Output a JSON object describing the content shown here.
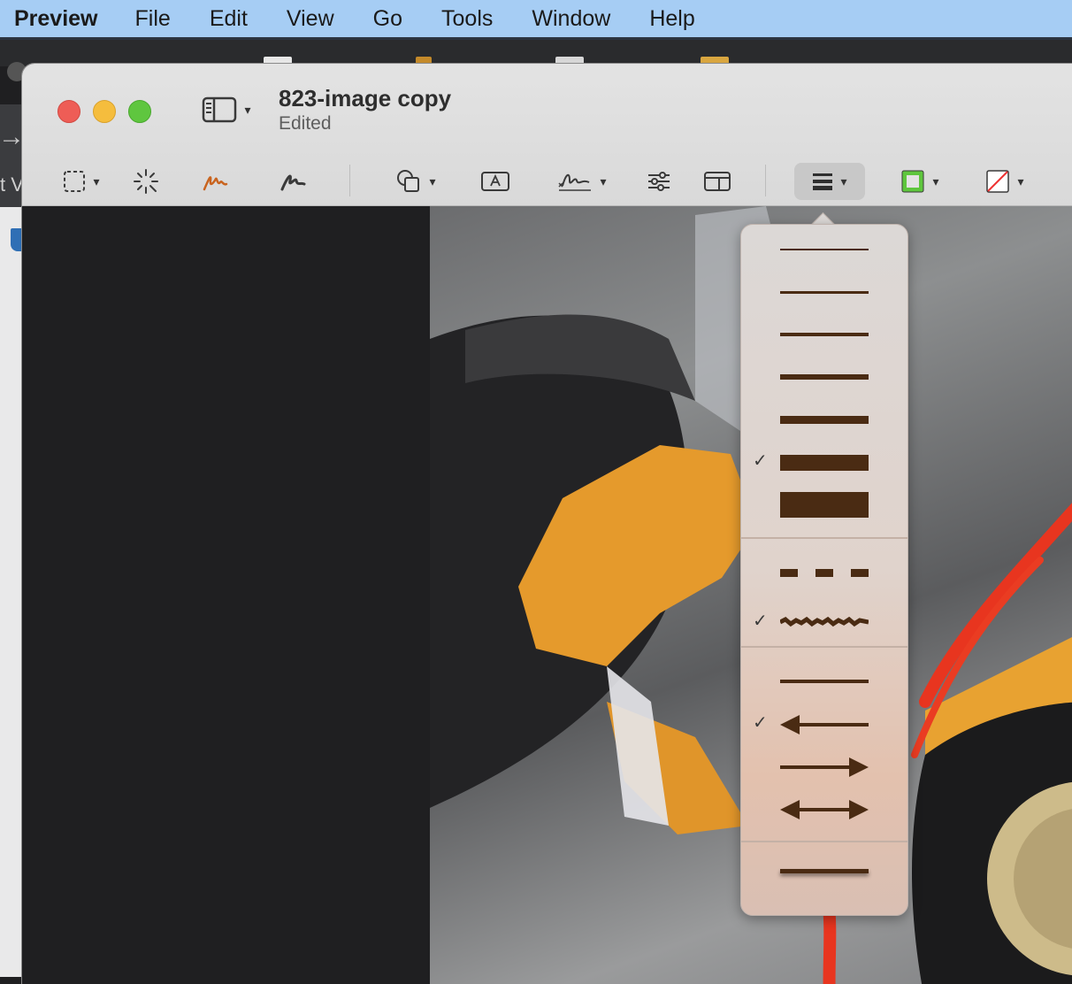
{
  "menubar": {
    "app": "Preview",
    "items": [
      "File",
      "Edit",
      "View",
      "Go",
      "Tools",
      "Window",
      "Help"
    ]
  },
  "window": {
    "title": "823-image copy",
    "subtitle": "Edited"
  },
  "toolbar": {
    "tools": [
      "rectangular-selection",
      "instant-alpha",
      "sketch",
      "draw",
      "shapes",
      "text",
      "sign",
      "adjust-color",
      "page-layout",
      "line-style",
      "border-color",
      "fill-color"
    ],
    "border_color": "#5ec63d",
    "fill_color": "none",
    "sketch_color": "#c9641f"
  },
  "edge": {
    "partial_text": "t V"
  },
  "line_style_menu": {
    "line_weights": [
      1,
      2,
      3,
      4,
      5,
      6,
      7
    ],
    "selected_weight": 6,
    "patterns": [
      "dashed",
      "textured"
    ],
    "selected_pattern": "textured",
    "endings": [
      "none",
      "arrow-left",
      "arrow-right",
      "arrow-both"
    ],
    "selected_ending": "arrow-left",
    "shadow": "shadow",
    "line_color": "#4a2b13"
  }
}
